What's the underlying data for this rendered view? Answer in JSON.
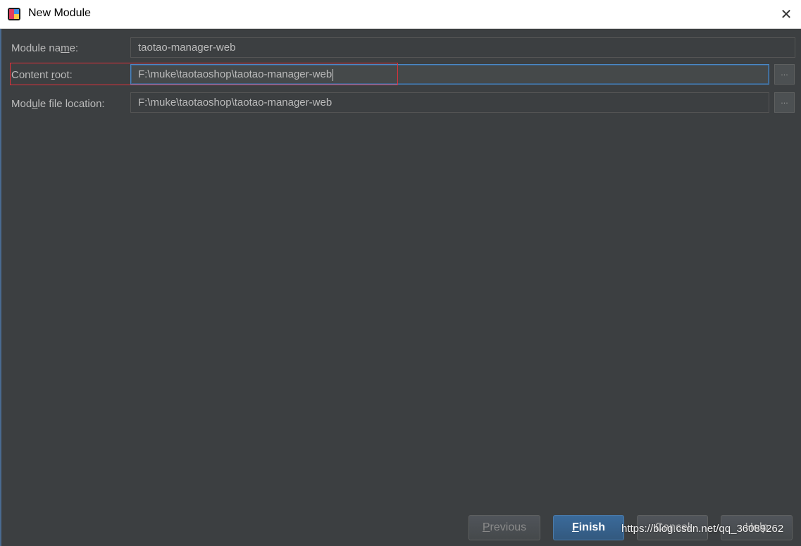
{
  "window": {
    "title": "New Module",
    "icon": "intellij-idea-icon",
    "close_label": "✕"
  },
  "form": {
    "module_name": {
      "label_pre": "Module na",
      "label_mn": "m",
      "label_post": "e:",
      "value": "taotao-manager-web"
    },
    "content_root": {
      "label_pre": "Content ",
      "label_mn": "r",
      "label_post": "oot:",
      "value": "F:\\muke\\taotaoshop\\taotao-manager-web",
      "browse_label": "..."
    },
    "module_file_location": {
      "label_pre": "Mod",
      "label_mn": "u",
      "label_post": "le file location:",
      "value": "F:\\muke\\taotaoshop\\taotao-manager-web",
      "browse_label": "..."
    }
  },
  "buttons": {
    "previous": {
      "mn": "P",
      "rest": "revious"
    },
    "finish": {
      "mn": "F",
      "rest": "inish"
    },
    "cancel": {
      "label": "Cancel"
    },
    "help": {
      "label": "Help"
    }
  },
  "watermark": "https://blog.csdn.net/qq_36089262",
  "colors": {
    "background": "#3c3f41",
    "field_bg": "#45494a",
    "focus_border": "#4a88c7",
    "highlight_box": "#e0303a",
    "primary_button": "#365880"
  }
}
